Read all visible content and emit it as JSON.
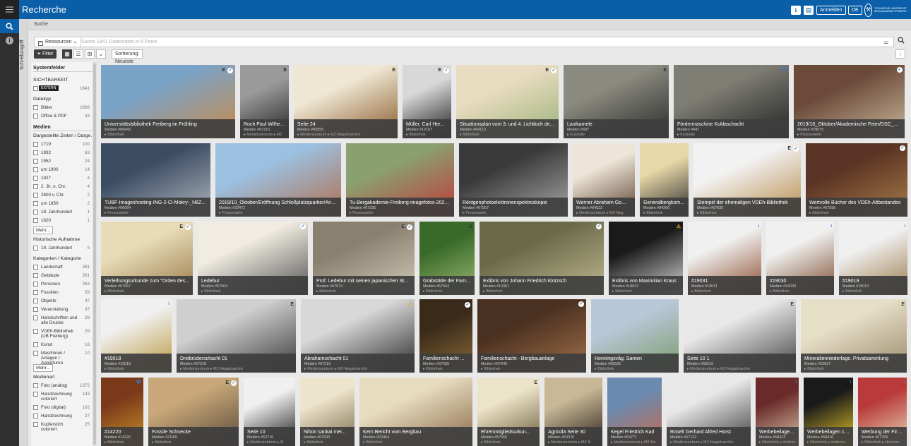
{
  "app": {
    "title": "Recherche",
    "login_label": "Anmelden",
    "lang_label": "DE",
    "logo_text": "TECHNISCHE UNIVERSITÄT BERGAKADEMIE FREIBERG",
    "accent": "#0a5fa8"
  },
  "toolbar": {
    "download_icon": "download-icon",
    "clipboard_icon": "clipboard-icon"
  },
  "siderail": {
    "search_icon": "search-icon",
    "info_icon": "info-icon",
    "vertical_tab": "Schreibzugriff"
  },
  "breadcrumb": "Suche",
  "search": {
    "pool_label": "Ressourcen",
    "placeholder": "Suche 1841 Datensätze in 6 Pools"
  },
  "tools": {
    "filter_label": "Filter",
    "sort_label": "Sortierung: Neueste"
  },
  "sidebar": {
    "heading": "Systemfelder",
    "visibility": {
      "title": "SICHTBARKEIT",
      "items": [
        {
          "label": "EXTERN",
          "count": "1841"
        }
      ]
    },
    "filetype": {
      "title": "Dateityp",
      "items": [
        {
          "label": "Bilder",
          "count": "1808"
        },
        {
          "label": "Office & PDF",
          "count": "33"
        }
      ]
    },
    "media_heading": "Medien",
    "times": {
      "title": "Dargestellte Zeiten / Darge…",
      "items": [
        {
          "label": "1719",
          "count": "100"
        },
        {
          "label": "1932",
          "count": "63"
        },
        {
          "label": "1952",
          "count": "24"
        },
        {
          "label": "um 1900",
          "count": "14"
        },
        {
          "label": "1927",
          "count": "4"
        },
        {
          "label": "2. Jh. n. Chr.",
          "count": "4"
        },
        {
          "label": "2800 v. Chr.",
          "count": "2"
        },
        {
          "label": "um 1850",
          "count": "2"
        },
        {
          "label": "18. Jahrhundert",
          "count": "1"
        },
        {
          "label": "1820",
          "count": "1"
        }
      ],
      "more": "Mehr..."
    },
    "historic": {
      "title": "Historische Aufnahme",
      "items": [
        {
          "label": "19. Jahrhundert",
          "count": "5"
        }
      ]
    },
    "categories": {
      "title": "Kategorien / Kategorie",
      "items": [
        {
          "label": "Landschaft",
          "count": "381"
        },
        {
          "label": "Gebäude",
          "count": "301"
        },
        {
          "label": "Personen",
          "count": "263"
        },
        {
          "label": "Fossilien",
          "count": "59"
        },
        {
          "label": "Objekte",
          "count": "47"
        },
        {
          "label": "Veranstaltung",
          "count": "37"
        },
        {
          "label": "Handschriften und alte Drucke",
          "count": "29"
        },
        {
          "label": "VDEh-Bibliothek (UB Freiberg)",
          "count": "29"
        },
        {
          "label": "Kunst",
          "count": "16"
        },
        {
          "label": "Maschinen / Anlagen / Apparturen",
          "count": "10"
        }
      ],
      "more": "Mehr..."
    },
    "mediatype": {
      "title": "Medienart",
      "items": [
        {
          "label": "Foto (analog)",
          "count": "1372"
        },
        {
          "label": "Handzeichnung coloriert",
          "count": "143"
        },
        {
          "label": "Foto (digital)",
          "count": "102"
        },
        {
          "label": "Handzeichnung",
          "count": "27"
        },
        {
          "label": "Kupferstich coloriert",
          "count": "25"
        }
      ]
    }
  },
  "rows": [
    [
      {
        "title": "Universitätsbibliothek Freiberg im Frühling",
        "sub": "Medien #66643",
        "pool": "▸ Bibliothek",
        "status": [
          "E",
          "on"
        ],
        "bg": [
          "#7aa3c8",
          "#c98a4a"
        ]
      },
      {
        "title": "Roch Paul Wilhel...",
        "sub": "Medien #67215",
        "pool": "▸ Medienzentrum ▸ MZ",
        "status": [
          "E"
        ],
        "bg": [
          "#9a9a9a",
          "#222222"
        ]
      },
      {
        "title": "Seite 24",
        "sub": "Medien #65555",
        "pool": "▸ Medienzentrum ▸ MZ-Negativarchiv",
        "status": [
          "E"
        ],
        "bg": [
          "#efe7d3",
          "#8a5a2a"
        ]
      },
      {
        "title": "Müller, Carl Her...",
        "sub": "Medien #12167",
        "pool": "▸ Bibliothek",
        "status": [
          "E",
          "on"
        ],
        "bg": [
          "#d8d8d8",
          "#1a1a1a"
        ]
      },
      {
        "title": "Situationsplan vom 3. und 4. Lichtloch de...",
        "sub": "Medien #64110",
        "pool": "▸ Bibliothek",
        "status": [
          "E",
          "on"
        ],
        "bg": [
          "#e8dcc0",
          "#9cb27a"
        ]
      },
      {
        "title": "Lastkamele",
        "sub": "Medien #697",
        "pool": "▸ Kustodie",
        "status": [
          "E"
        ],
        "bg": [
          "#8a8a80",
          "#2a2a2a"
        ]
      },
      {
        "title": "Fördermaschine Kuklaschacht",
        "sub": "Medien #647",
        "pool": "▸ Kustodie",
        "status": [
          "👁",
          "b"
        ],
        "bg": [
          "#7d7d74",
          "#222222"
        ]
      },
      {
        "title": "2019/10_Oktober/Akademische Feier/DSC_7307...",
        "sub": "Medien #29075",
        "pool": "▸ Pressestelle",
        "status": [
          "on"
        ],
        "bg": [
          "#6b4a3a",
          "#c9b79a"
        ]
      }
    ],
    [
      {
        "title": "TUBF-Imageshooting-ING-2-Cl-Mokry-_N6Z...",
        "sub": "Medien #66064",
        "pool": "▸ Pressestelle",
        "status": [],
        "bg": [
          "#3b4c63",
          "#b0b6bd"
        ]
      },
      {
        "title": "2019/10_Oktober/Eröffnung Schloßplatzquartier/Ansi...",
        "sub": "Medien #23472",
        "pool": "▸ Pressestelle",
        "status": [],
        "bg": [
          "#9cc0e0",
          "#b07050"
        ]
      },
      {
        "title": "Tu-Bergakademie-Freiberg-imagefotos-2020...",
        "sub": "Medien #67335",
        "pool": "▸ Pressestelle",
        "status": [],
        "bg": [
          "#8aa070",
          "#c03a3a"
        ]
      },
      {
        "title": "Röntgenphotoelektronenspektroskopie",
        "sub": "Medien #67557",
        "pool": "▸ Pressestelle",
        "status": [],
        "bg": [
          "#3a3a3a",
          "#a8a8a8"
        ]
      },
      {
        "title": "Werner Abraham Go...",
        "sub": "Medien #64522",
        "pool": "▸ Medienzentrum ▸ MZ-Neg",
        "status": [],
        "bg": [
          "#ede6d8",
          "#5a4030"
        ]
      },
      {
        "title": "Generalbergkom...",
        "sub": "Medien #84266",
        "pool": "▸ Bibliothek",
        "status": [],
        "bg": [
          "#e8d8a8",
          "#2a2a2a"
        ]
      },
      {
        "title": "Stempel der ehemaligen VDEh-Bibliothek",
        "sub": "Medien #67635",
        "pool": "▸ Bibliothek",
        "status": [
          "E",
          "on"
        ],
        "bg": [
          "#f2f2f2",
          "#b88a4a"
        ]
      },
      {
        "title": "Wertvolle Bücher des VDEh-Altbestandes",
        "sub": "Medien #67598",
        "pool": "▸ Bibliothek",
        "status": [
          "on"
        ],
        "bg": [
          "#5a3424",
          "#a87a4a"
        ]
      }
    ],
    [
      {
        "title": "Verleihungsurkunde zum \"Orden des...",
        "sub": "Medien #67567",
        "pool": "▸ Bibliothek",
        "status": [
          "E",
          "on"
        ],
        "bg": [
          "#e8dcb8",
          "#9a7a4a"
        ]
      },
      {
        "title": "Ledebur",
        "sub": "Medien #67564",
        "pool": "▸ Bibliothek",
        "status": [
          "on"
        ],
        "bg": [
          "#f0ece2",
          "#555555"
        ]
      },
      {
        "title": "Prof. Ledebur mit seinen japanischen St...",
        "sub": "Medien #67574",
        "pool": "▸ Bibliothek",
        "status": [
          "E",
          "on"
        ],
        "bg": [
          "#8a8070",
          "#d0c8b8"
        ]
      },
      {
        "title": "Grabstätte der Fam...",
        "sub": "Medien #67604",
        "pool": "▸ Bibliothek",
        "status": [
          "E"
        ],
        "bg": [
          "#3a6a2a",
          "#9ab870"
        ]
      },
      {
        "title": "Exlibris von Johann Friedrich Klotzsch",
        "sub": "Medien #13361",
        "pool": "▸ Bibliothek",
        "status": [
          "on"
        ],
        "bg": [
          "#6a6a4a",
          "#c0b890"
        ]
      },
      {
        "title": "Exlibris von Maximilian Kraus",
        "sub": "Medien #18022",
        "pool": "▸ Bibliothek",
        "status": [
          "⚠",
          "w"
        ],
        "bg": [
          "#1a1a1a",
          "#d8d8d8"
        ]
      },
      {
        "title": "#19031",
        "sub": "Medien #19031",
        "pool": "▸ Bibliothek",
        "status": [
          "i",
          "b"
        ],
        "bg": [
          "#f0f0f0",
          "#8a4a2a"
        ]
      },
      {
        "title": "#19030",
        "sub": "Medien #19030",
        "pool": "▸ Bibliothek",
        "status": [
          "i",
          "b"
        ],
        "bg": [
          "#f0f0f0",
          "#7a4a2a"
        ]
      },
      {
        "title": "#19019",
        "sub": "Medien #19019",
        "pool": "▸ Bibliothek",
        "status": [
          "i",
          "b"
        ],
        "bg": [
          "#f0f0f0",
          "#9a7a4a"
        ]
      }
    ],
    [
      {
        "title": "#19018",
        "sub": "Medien #19018",
        "pool": "▸ Bibliothek",
        "status": [
          "i",
          "b"
        ],
        "bg": [
          "#f0f0f0",
          "#b8963a"
        ]
      },
      {
        "title": "Dreibrüderschacht 01",
        "sub": "Medien #67218",
        "pool": "▸ Medienzentrum ▸ MZ-Negativarchiv",
        "status": [
          "E"
        ],
        "bg": [
          "#cfcfcf",
          "#3a3a3a"
        ]
      },
      {
        "title": "Abrahamschacht 01",
        "sub": "Medien #67219",
        "pool": "▸ Medienzentrum ▸ MZ-Negativarchiv",
        "status": [
          "⚠",
          "w"
        ],
        "bg": [
          "#d8d8d8",
          "#2a2a2a"
        ]
      },
      {
        "title": "Familienschacht ...",
        "sub": "Medien #67035",
        "pool": "▸ Bibliothek",
        "status": [
          "E",
          "on"
        ],
        "bg": [
          "#3a2a1a",
          "#8a6a3a"
        ]
      },
      {
        "title": "Familienschacht - Bergbauanlage",
        "sub": "Medien #67040",
        "pool": "▸ Bibliothek",
        "status": [
          "on"
        ],
        "bg": [
          "#4a3020",
          "#a0704a"
        ]
      },
      {
        "title": "Honningsvåg. Samen",
        "sub": "Medien #66595",
        "pool": "▸ Bibliothek",
        "status": [],
        "bg": [
          "#b8c8d8",
          "#7a9a6a"
        ]
      },
      {
        "title": "Seite 10 1",
        "sub": "Medien #65516",
        "pool": "▸ Medienzentrum ▸ MZ-Negativarchiv",
        "status": [
          "E"
        ],
        "bg": [
          "#e8e8e8",
          "#444444"
        ]
      },
      {
        "title": "Mineralienniederlage. Privatsammlung",
        "sub": "Medien #22637",
        "pool": "▸ Bibliothek",
        "status": [
          "E"
        ],
        "bg": [
          "#e6dfc8",
          "#9a8a6a"
        ]
      }
    ],
    [
      {
        "title": "#14220",
        "sub": "Medien #14220",
        "pool": "▸ Bibliothek",
        "status": [
          "👁",
          "b"
        ],
        "bg": [
          "#7a3a1a",
          "#c8902a"
        ]
      },
      {
        "title": "Fossile Schnecke",
        "sub": "Medien #21901",
        "pool": "▸ Bibliothek",
        "status": [
          "E",
          "on"
        ],
        "bg": [
          "#c8a878",
          "#5a4a3a"
        ]
      },
      {
        "title": "Seite 10",
        "sub": "Medien #63716",
        "pool": "▸ Medienzentrum ▸ M",
        "status": [],
        "bg": [
          "#f0f0f0",
          "#1a1a1a"
        ]
      },
      {
        "title": "Nihon sankai mei...",
        "sub": "Medien #67600",
        "pool": "▸ Bibliothek",
        "status": [],
        "bg": [
          "#ede4cc",
          "#7a6a4a"
        ]
      },
      {
        "title": "Kern Bericht vom Bergbau",
        "sub": "Medien #22454",
        "pool": "▸ Bibliothek",
        "status": [],
        "bg": [
          "#e8dcc0",
          "#8a6a4a"
        ]
      },
      {
        "title": "Ehrenmitgliedsurkun...",
        "sub": "Medien #67566",
        "pool": "▸ Bibliothek",
        "status": [
          "E"
        ],
        "bg": [
          "#ece4c8",
          "#6a5a3a"
        ]
      },
      {
        "title": "Agricola Seite 30",
        "sub": "Medien #63376",
        "pool": "▸ Medienzentrum ▸ MZ-N",
        "status": [],
        "bg": [
          "#c8b898",
          "#2a2018"
        ]
      },
      {
        "title": "Kegel Friedrich Karl",
        "sub": "Medien #64771",
        "pool": "▸ Medienzentrum ▸ MZ-Ne",
        "status": [],
        "bg": [
          "#6a8ab0",
          "#c86a4a"
        ]
      },
      {
        "title": "Roselt Gerhard Alfred Horst",
        "sub": "Medien #67122",
        "pool": "▸ Medienzentrum ▸ MZ-Negativarchiv",
        "status": [],
        "bg": [
          "#e8e8e8",
          "#3a3a3a"
        ]
      },
      {
        "title": "Werbebeilage Stah...",
        "sub": "Medien #68413",
        "pool": "▸ Bibliothek ▸ Historisc",
        "status": [
          "i",
          "b"
        ],
        "bg": [
          "#6a2a2a",
          "#d8c8a8"
        ]
      },
      {
        "title": "Werbebeilagen 1927",
        "sub": "Medien #68416",
        "pool": "▸ Bibliothek ▸ Historisc",
        "status": [
          "i",
          "b"
        ],
        "bg": [
          "#1a1a1a",
          "#e8c82a"
        ]
      },
      {
        "title": "Werbung der Firm...",
        "sub": "Medien #67769",
        "pool": "▸ Bibliothek ▸ Historisc",
        "status": [
          "i",
          "b"
        ],
        "bg": [
          "#b83a3a",
          "#e8d8b8"
        ]
      }
    ]
  ]
}
